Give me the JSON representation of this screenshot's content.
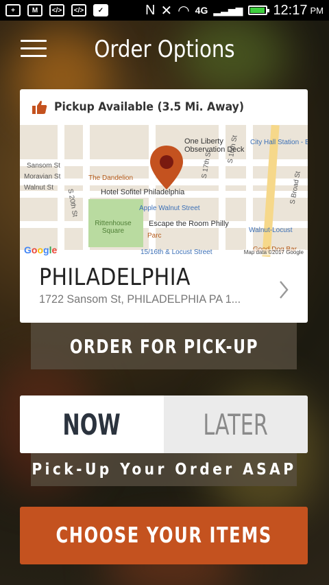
{
  "status_bar": {
    "time": "12:17",
    "ampm": "PM",
    "network": "4G",
    "battery_level": 0.85
  },
  "header": {
    "title": "Order Options"
  },
  "location_card": {
    "pickup_text": "Pickup Available (3.5 Mi. Away)",
    "name": "PHILADELPHIA",
    "address": "1722 Sansom St, PHILADELPHIA PA 1..."
  },
  "map": {
    "labels": {
      "sansom": "Sansom St",
      "moravian": "Moravian St",
      "walnut": "Walnut St",
      "s20th": "S 20th St",
      "dandelion": "The Dandelion",
      "sofitel": "Hotel Sofitel Philadelphia",
      "apple": "Apple Walnut Street",
      "rittenhouse": "Rittenhouse Square",
      "escape": "Escape the Room Philly",
      "parc": "Parc",
      "one_liberty": "One Liberty Observation Deck",
      "city_hall": "City Hall Station - BS",
      "walnut_locust": "Walnut-Locust",
      "s_broad": "S Broad St",
      "s16th": "S 16th St",
      "s17th": "S 17th St",
      "locust_station": "15/16th & Locust Street",
      "good_dog": "Good Dog Bar",
      "map_data": "Map data ©2017 Google"
    },
    "google_letters": [
      "G",
      "o",
      "o",
      "g",
      "l",
      "e"
    ]
  },
  "order_type": {
    "label": "ORDER FOR PICK-UP"
  },
  "timing": {
    "now_label": "NOW",
    "later_label": "LATER",
    "selected": "now"
  },
  "timing_note": "Pick-Up Your Order ASAP",
  "cta": {
    "label": "CHOOSE YOUR ITEMS"
  },
  "colors": {
    "accent": "#c4521f",
    "pin": "#c4521f",
    "dark_text": "#2b333e"
  }
}
